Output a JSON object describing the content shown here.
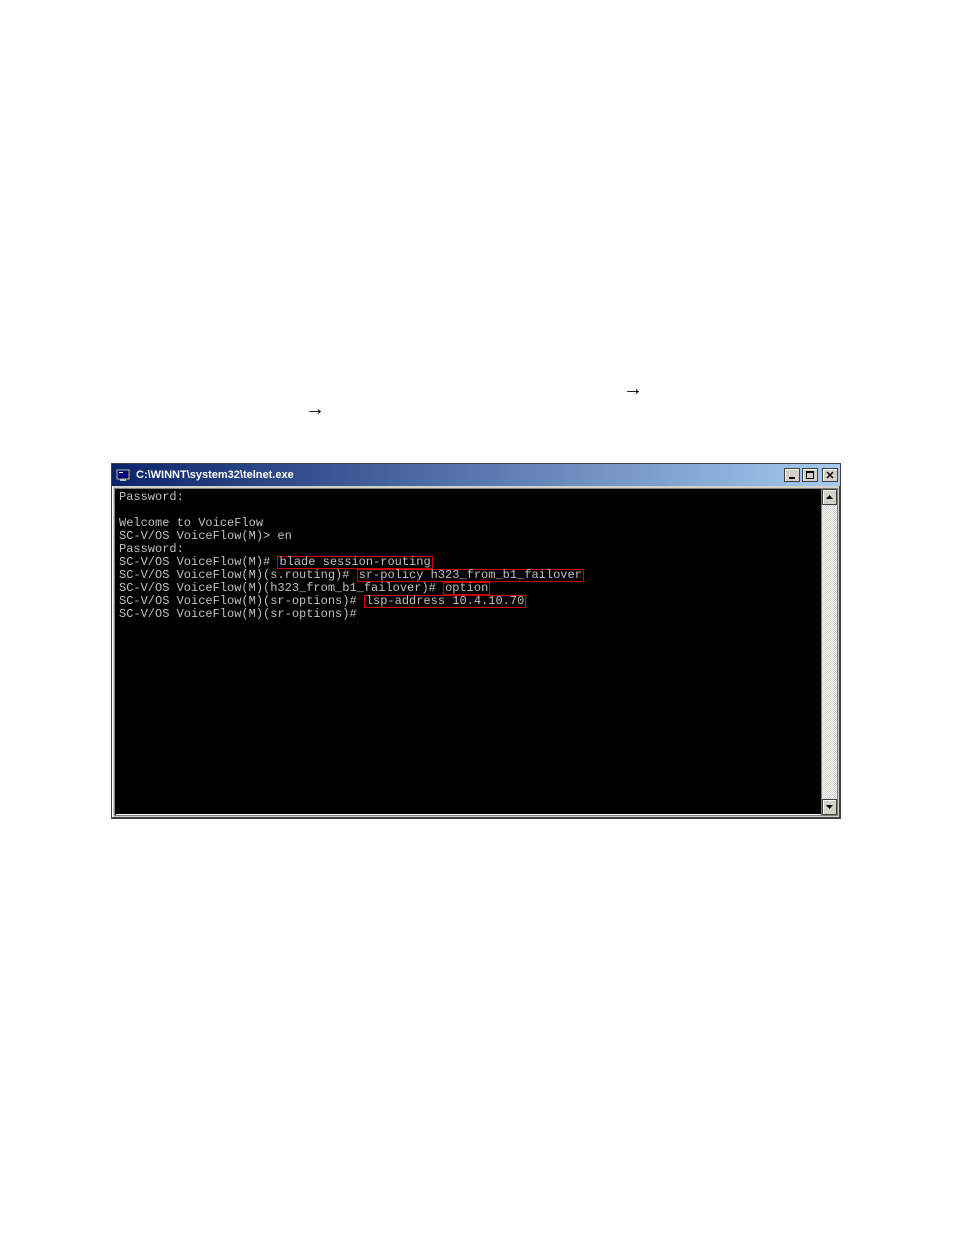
{
  "arrows": {
    "a1": "→",
    "a2": "→"
  },
  "window": {
    "title": "C:\\WINNT\\system32\\telnet.exe",
    "buttons": {
      "min": "_",
      "max": "❐",
      "close": "✕"
    }
  },
  "terminal": {
    "lines": [
      {
        "pre": "Password:",
        "hl": "",
        "post": ""
      },
      {
        "pre": "",
        "hl": "",
        "post": ""
      },
      {
        "pre": "Welcome to VoiceFlow",
        "hl": "",
        "post": ""
      },
      {
        "pre": "SC-V/OS VoiceFlow(M)> en",
        "hl": "",
        "post": ""
      },
      {
        "pre": "Password:",
        "hl": "",
        "post": ""
      },
      {
        "pre": "SC-V/OS VoiceFlow(M)# ",
        "hl": "blade session-routing",
        "post": ""
      },
      {
        "pre": "SC-V/OS VoiceFlow(M)(s.routing)# ",
        "hl": "sr-policy h323_from_b1_failover",
        "post": ""
      },
      {
        "pre": "SC-V/OS VoiceFlow(M)(h323_from_b1_failover)# ",
        "hl": "option",
        "post": ""
      },
      {
        "pre": "SC-V/OS VoiceFlow(M)(sr-options)# ",
        "hl": "lsp-address 10.4.10.70",
        "post": ""
      },
      {
        "pre": "SC-V/OS VoiceFlow(M)(sr-options)#",
        "hl": "",
        "post": ""
      }
    ]
  }
}
